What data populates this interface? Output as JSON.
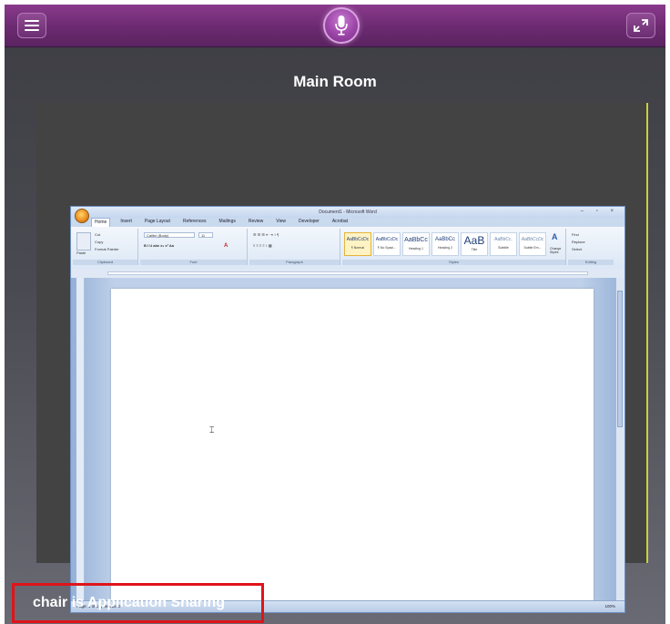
{
  "room": {
    "title": "Main Room"
  },
  "status": {
    "sharing_text": "chair is Application Sharing"
  },
  "icons": {
    "menu": "hamburger-icon",
    "mic": "microphone-icon",
    "expand": "expand-icon"
  },
  "colors": {
    "topbar": "#6b2a70",
    "accent_border": "#c8d13a",
    "highlight_red": "#e0141a"
  },
  "shared_app": {
    "window_title": "Document1 - Microsoft Word",
    "tabs": [
      "Home",
      "Insert",
      "Page Layout",
      "References",
      "Mailings",
      "Review",
      "View",
      "Developer",
      "Acrobat"
    ],
    "ribbon": {
      "clipboard": {
        "label": "Clipboard",
        "paste": "Paste",
        "cut": "Cut",
        "copy": "Copy",
        "format_painter": "Format Painter"
      },
      "font": {
        "label": "Font",
        "font_name": "Calibri (Body)",
        "font_size": "11"
      },
      "paragraph": {
        "label": "Paragraph"
      },
      "styles": {
        "label": "Styles",
        "items": [
          {
            "sample": "AaBbCcDc",
            "name": "¶ Normal"
          },
          {
            "sample": "AaBbCcDc",
            "name": "¶ No Spaci..."
          },
          {
            "sample": "AaBbCc",
            "name": "Heading 1"
          },
          {
            "sample": "AaBbCc",
            "name": "Heading 2"
          },
          {
            "sample": "AaB",
            "name": "Title"
          },
          {
            "sample": "AaBbCc.",
            "name": "Subtitle"
          },
          {
            "sample": "AaBbCcDc",
            "name": "Subtle Em..."
          }
        ],
        "change_styles": "Change Styles"
      },
      "editing": {
        "label": "Editing",
        "find": "Find",
        "replace": "Replace",
        "select": "Select"
      }
    },
    "statusbar": {
      "page": "Page: 1 of 1",
      "words": "Words: 0",
      "zoom": "100%"
    }
  }
}
